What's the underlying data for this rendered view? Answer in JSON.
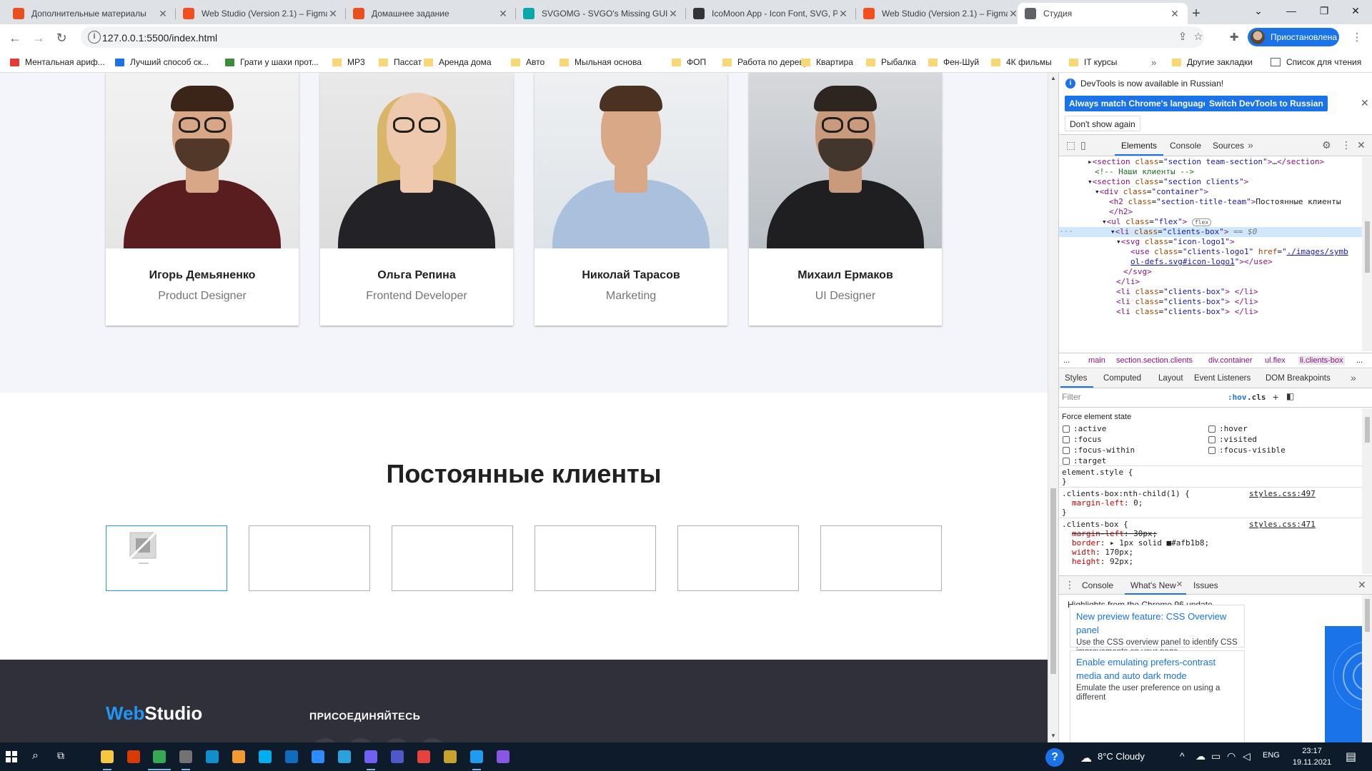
{
  "browser": {
    "tabs": [
      {
        "title": "Дополнительные материалы",
        "favicon_color": "#e8501f",
        "favicon": "goit-icon"
      },
      {
        "title": "Web Studio (Version 2.1) – Figma",
        "favicon_color": "#f24e1e",
        "favicon": "figma-icon"
      },
      {
        "title": "Домашнее задание",
        "favicon_color": "#e8501f",
        "favicon": "goit-icon"
      },
      {
        "title": "SVGOMG - SVGO's Missing GUI",
        "favicon_color": "#0aa8a8",
        "favicon": "svgomg-icon"
      },
      {
        "title": "IcoMoon App - Icon Font, SVG, P",
        "favicon_color": "#333333",
        "favicon": "icomoon-icon"
      },
      {
        "title": "Web Studio (Version 2.1) – Figma",
        "favicon_color": "#f24e1e",
        "favicon": "figma-icon"
      },
      {
        "title": "Студия",
        "favicon_color": "#5f6368",
        "favicon": "globe-icon"
      }
    ],
    "url": "127.0.0.1:5500/index.html",
    "profile_label": "Приостановлена",
    "bookmarks": [
      "Ментальная ариф...",
      "Лучший способ ск...",
      "Грати у шахи прот...",
      "MP3",
      "Пассат",
      "Аренда дома",
      "Авто",
      "Мыльная основа",
      "ФОП",
      "Работа по дереву",
      "Квартира",
      "Рыбалка",
      "Фен-Шуй",
      "4К фильмы",
      "IT курсы"
    ],
    "other_bookmarks": "Другие закладки",
    "reading_list": "Список для чтения"
  },
  "page": {
    "team": [
      {
        "name": "Игорь Демьяненко",
        "role": "Product Designer"
      },
      {
        "name": "Ольга Репина",
        "role": "Frontend Developer"
      },
      {
        "name": "Николай Тарасов",
        "role": "Marketing"
      },
      {
        "name": "Михаил Ермаков",
        "role": "UI Designer"
      }
    ],
    "clients_title": "Постоянные клиенты",
    "client_boxes": 6,
    "footer": {
      "logo_part1": "Web",
      "logo_part2": "Studio",
      "join_heading": "ПРИСОЕДИНЯЙТЕСЬ"
    }
  },
  "devtools": {
    "infobar_message": "DevTools is now available in Russian!",
    "btn_match": "Always match Chrome's language",
    "btn_switch": "Switch DevTools to Russian",
    "btn_dont_show": "Don't show again",
    "tabs": [
      "Elements",
      "Console",
      "Sources"
    ],
    "crumbs": [
      "...",
      "main",
      "section.section.clients",
      "div.container",
      "ul.flex",
      "li.clients-box",
      "..."
    ],
    "sub_tabs": [
      "Styles",
      "Computed",
      "Layout",
      "Event Listeners",
      "DOM Breakpoints"
    ],
    "filter_placeholder": "Filter",
    "hov": ":hov",
    "cls": ".cls",
    "force_state_label": "Force element state",
    "states_left": [
      ":active",
      ":focus",
      ":focus-within",
      ":target"
    ],
    "states_right": [
      ":hover",
      ":visited",
      ":focus-visible"
    ],
    "element_style": "element.style {",
    "rule1_selector": ".clients-box:nth-child(1) {",
    "rule1_source": "styles.css:497",
    "rule1_prop": "margin-left",
    "rule1_val": "0;",
    "rule2_selector": ".clients-box {",
    "rule2_source": "styles.css:471",
    "rule2_props": [
      {
        "prop": "margin-left",
        "val": "30px;",
        "struck": true
      },
      {
        "prop": "border",
        "val": "▸ 1px solid ■#afb1b8;",
        "struck": false
      },
      {
        "prop": "width",
        "val": "170px;",
        "struck": false
      },
      {
        "prop": "height",
        "val": "92px;",
        "struck": false
      }
    ],
    "drawer_tabs": [
      "Console",
      "What's New",
      "Issues"
    ],
    "whats_new_heading": "Highlights from the Chrome 96 update",
    "wn_cards": [
      {
        "title": "New preview feature: CSS Overview panel",
        "body": "Use the CSS overview panel to identify CSS improvements on your page."
      },
      {
        "title": "Enable emulating prefers-contrast media and auto dark mode",
        "body": "Emulate the user preference on using a different"
      }
    ]
  },
  "taskbar": {
    "weather": "8°C  Cloudy",
    "lang": "ENG",
    "time": "23:17",
    "date": "19.11.2021"
  }
}
